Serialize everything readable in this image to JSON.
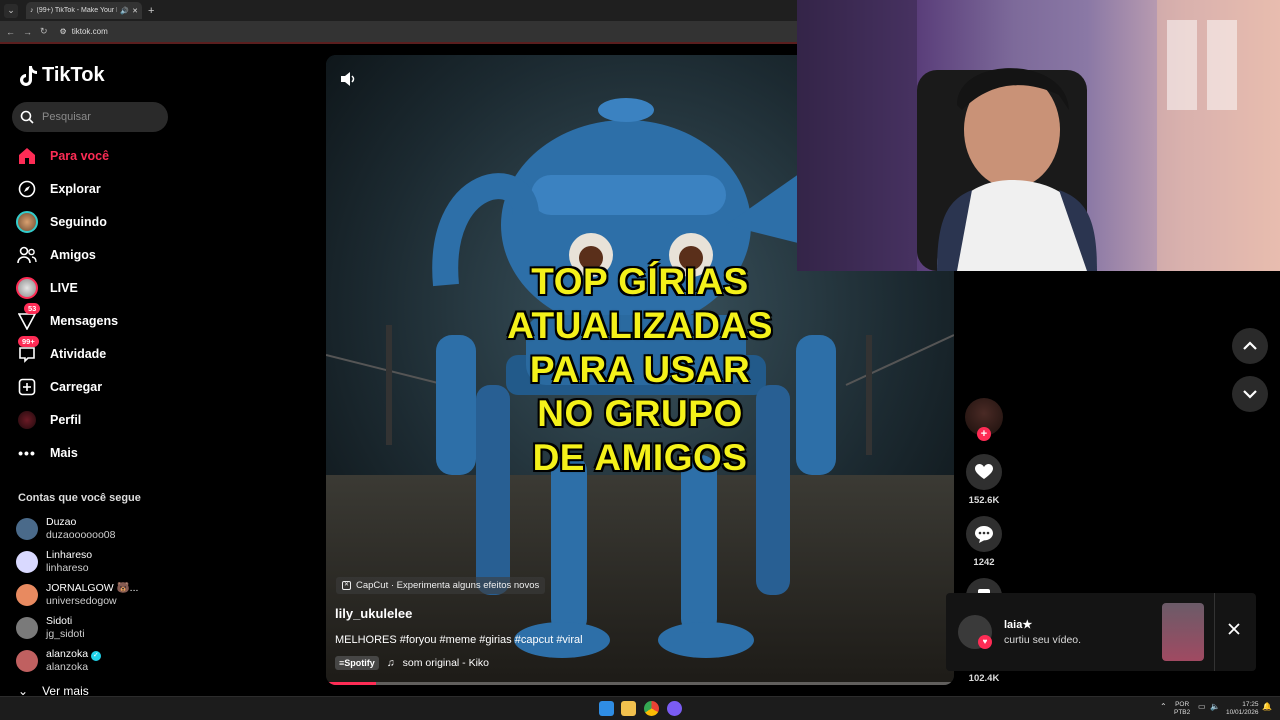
{
  "browser": {
    "tab_title": "(99+) TikTok - Make Your Da",
    "url": "tiktok.com",
    "new_tab_symbol": "+",
    "tab_close_symbol": "✕"
  },
  "sidebar": {
    "logo_text": "TikTok",
    "search_placeholder": "Pesquisar",
    "nav": [
      {
        "label": "Para você",
        "icon": "home-icon",
        "active": true
      },
      {
        "label": "Explorar",
        "icon": "compass-icon"
      },
      {
        "label": "Seguindo",
        "icon": "following-avatar-icon"
      },
      {
        "label": "Amigos",
        "icon": "friends-icon"
      },
      {
        "label": "LIVE",
        "icon": "live-icon"
      },
      {
        "label": "Mensagens",
        "icon": "messages-icon",
        "badge": "53"
      },
      {
        "label": "Atividade",
        "icon": "activity-icon",
        "badge": "99+"
      },
      {
        "label": "Carregar",
        "icon": "upload-icon"
      },
      {
        "label": "Perfil",
        "icon": "profile-icon"
      },
      {
        "label": "Mais",
        "icon": "more-icon"
      }
    ],
    "following_title": "Contas que você segue",
    "accounts": [
      {
        "name": "Duzao",
        "handle": "duzaoooooo08",
        "color": "#4a6a8a"
      },
      {
        "name": "Linhareso",
        "handle": "linhareso",
        "color": "#d9d9ff"
      },
      {
        "name": "JORNALGOW 🐻...",
        "handle": "universedogow",
        "color": "#e88a60"
      },
      {
        "name": "Sidoti",
        "handle": "jg_sidoti",
        "color": "#7a7a7a"
      },
      {
        "name": "alanzoka",
        "handle": "alanzoka",
        "color": "#c06060",
        "verified": true
      }
    ],
    "see_more": "Ver mais"
  },
  "video": {
    "headline_lines": [
      "TOP GÍRIAS",
      "ATUALIZADAS",
      "PARA USAR",
      "NO GRUPO",
      "DE AMIGOS"
    ],
    "capcut_label": "CapCut · Experimenta alguns efeitos novos",
    "author": "lily_ukulelee",
    "description": "MELHORES #foryou  #meme #girias #capcut #viral",
    "spotify_label": "Spotify",
    "music": "som original - Kiko",
    "progress_fraction": 0.08
  },
  "actions": {
    "likes": "152.6K",
    "comments": "1242",
    "shares": "102.4K"
  },
  "notification": {
    "user": "laia★",
    "message": "curtiu seu vídeo."
  },
  "taskbar": {
    "lang_top": "POR",
    "lang_bottom": "PTB2",
    "time": "17:25",
    "date": "10/01/2026"
  },
  "colors": {
    "accent": "#fe2c55",
    "headline": "#f4f11a"
  }
}
